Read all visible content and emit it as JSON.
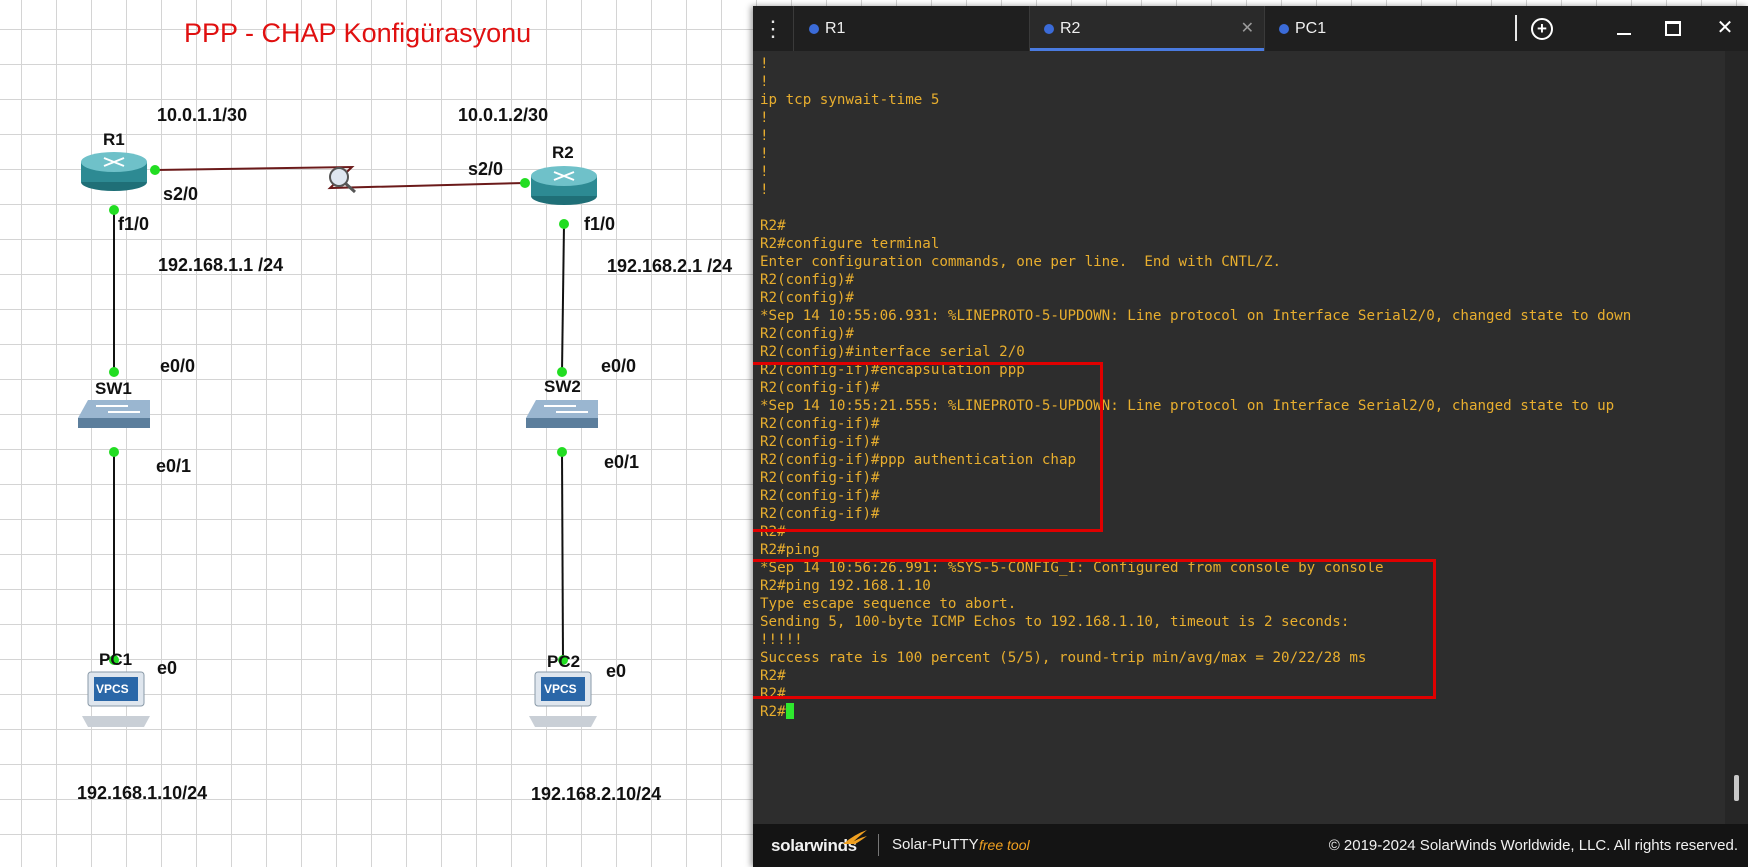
{
  "topology": {
    "title": "PPP  - CHAP Konfigürasyonu",
    "nodes": {
      "r1": "R1",
      "r2": "R2",
      "sw1": "SW1",
      "sw2": "SW2",
      "pc1": "PC1",
      "pc2": "PC2",
      "vpcs": "VPCS"
    },
    "labels": {
      "r1_serial_ip": "10.0.1.1/30",
      "r2_serial_ip": "10.0.1.2/30",
      "r1_s20": "s2/0",
      "r2_s20": "s2/0",
      "r1_f10": "f1/0",
      "r2_f10": "f1/0",
      "r1_lan_ip": "192.168.1.1 /24",
      "r2_lan_ip": "192.168.2.1 /24",
      "sw1_e00": "e0/0",
      "sw2_e00": "e0/0",
      "sw1_e01": "e0/1",
      "sw2_e01": "e0/1",
      "pc1_e0": "e0",
      "pc2_e0": "e0",
      "pc1_ip": "192.168.1.10/24",
      "pc2_ip": "192.168.2.10/24"
    }
  },
  "terminal": {
    "tabs": [
      {
        "label": "R1"
      },
      {
        "label": "R2"
      },
      {
        "label": "PC1"
      }
    ],
    "active_tab": "R2",
    "accent_color": "#4a7be0",
    "text_color": "#e8ae2e",
    "lines": [
      "!",
      "!",
      "ip tcp synwait-time 5",
      "!",
      "!",
      "!",
      "!",
      "!",
      "",
      "R2#",
      "R2#configure terminal",
      "Enter configuration commands, one per line.  End with CNTL/Z.",
      "R2(config)#",
      "R2(config)#",
      "*Sep 14 10:55:06.931: %LINEPROTO-5-UPDOWN: Line protocol on Interface Serial2/0, changed state to down",
      "R2(config)#",
      "R2(config)#interface serial 2/0",
      "R2(config-if)#encapsulation ppp",
      "R2(config-if)#",
      "*Sep 14 10:55:21.555: %LINEPROTO-5-UPDOWN: Line protocol on Interface Serial2/0, changed state to up",
      "R2(config-if)#",
      "R2(config-if)#",
      "R2(config-if)#ppp authentication chap",
      "R2(config-if)#",
      "R2(config-if)#",
      "R2(config-if)#",
      "R2#",
      "R2#ping",
      "*Sep 14 10:56:26.991: %SYS-5-CONFIG_I: Configured from console by console",
      "R2#ping 192.168.1.10",
      "Type escape sequence to abort.",
      "Sending 5, 100-byte ICMP Echos to 192.168.1.10, timeout is 2 seconds:",
      "!!!!!",
      "Success rate is 100 percent (5/5), round-trip min/avg/max = 20/22/28 ms",
      "R2#",
      "R2#",
      "R2#"
    ],
    "prompt": "R2#"
  },
  "footer": {
    "brand": "solarwinds",
    "product": "Solar-PuTTY",
    "free_tag": "free tool",
    "copyright": "© 2019-2024 SolarWinds Worldwide, LLC. All rights reserved."
  }
}
